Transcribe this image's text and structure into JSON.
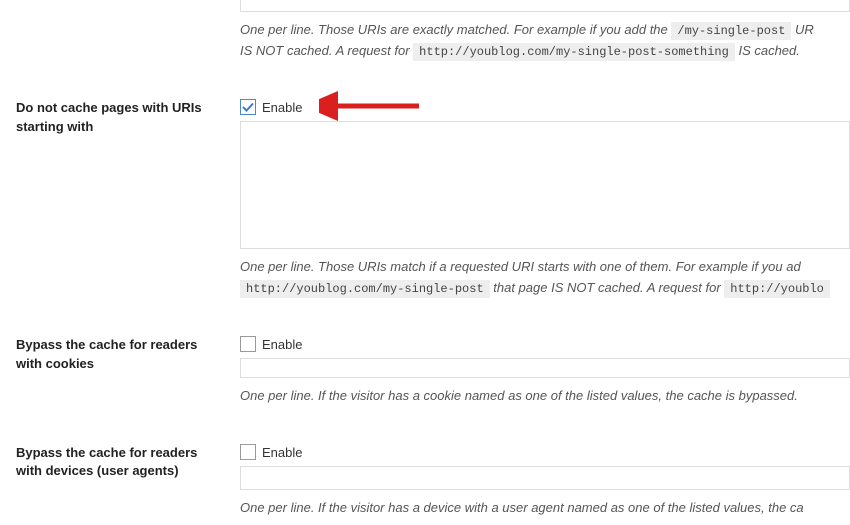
{
  "section0": {
    "help_prefix": "One per line. Those URIs are exactly matched. For example if you add the ",
    "help_code1": "/my-single-post",
    "help_mid1": " UR",
    "help_mid2": "IS NOT cached. A request for ",
    "help_code2": "http://youblog.com/my-single-post-something",
    "help_end": " IS cached."
  },
  "section1": {
    "label": "Do not cache pages with URIs starting with",
    "enable_label": "Enable",
    "checked": true,
    "help_prefix": "One per line. Those URIs match if a requested URI starts with one of them. For example if you ad",
    "help_code1": "http://youblog.com/my-single-post",
    "help_mid1": " that page IS NOT cached. A request for ",
    "help_code2": "http://youblo"
  },
  "section2": {
    "label": "Bypass the cache for readers with cookies",
    "enable_label": "Enable",
    "checked": false,
    "help_text": "One per line. If the visitor has a cookie named as one of the listed values, the cache is bypassed."
  },
  "section3": {
    "label": "Bypass the cache for readers with devices (user agents)",
    "enable_label": "Enable",
    "checked": false,
    "help_text": "One per line. If the visitor has a device with a user agent named as one of the listed values, the ca"
  }
}
